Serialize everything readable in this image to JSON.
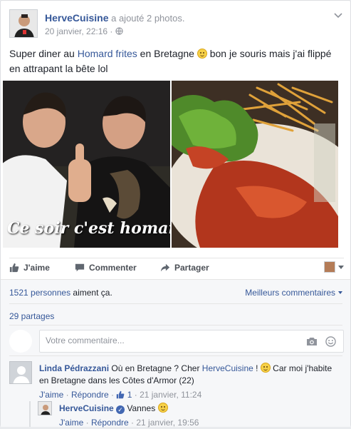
{
  "post": {
    "author": "HerveCuisine",
    "action": "a ajouté 2 photos.",
    "timestamp": "20 janvier, 22:16",
    "privacy_sep": "·",
    "text_1": "Super diner au ",
    "text_link_1": "Homard",
    "text_space": " ",
    "text_link_2": "frites",
    "text_2": " en Bretagne ",
    "text_3": " bon je souris mais j'ai flippé en attrapant la bête lol",
    "photo1_caption": "Ce soir c'est homard !"
  },
  "actions": {
    "like": "J'aime",
    "comment": "Commenter",
    "share": "Partager"
  },
  "feedback": {
    "likes_count": "1521 personnes",
    "likes_text": " aiment ça.",
    "best_comments": "Meilleurs commentaires",
    "shares": "29 partages",
    "comment_placeholder": "Votre commentaire..."
  },
  "comments": [
    {
      "author": "Linda Pédrazzani",
      "text_1": " Où en Bretagne ? Cher ",
      "mention": "HerveCuisine",
      "text_2": " ! ",
      "text_3": " Car moi j'habite en Bretagne dans les Côtes d'Armor (22)",
      "like": "J'aime",
      "reply": "Répondre",
      "likes": "1",
      "time": "21 janvier, 11:24"
    }
  ],
  "reply": {
    "author": "HerveCuisine",
    "text": "Vannes ",
    "like": "J'aime",
    "reply": "Répondre",
    "time": "21 janvier, 19:56"
  },
  "sep_dot": " · ",
  "colors": {
    "link": "#365899",
    "muted": "#90949c",
    "accent": "#4267b2"
  }
}
